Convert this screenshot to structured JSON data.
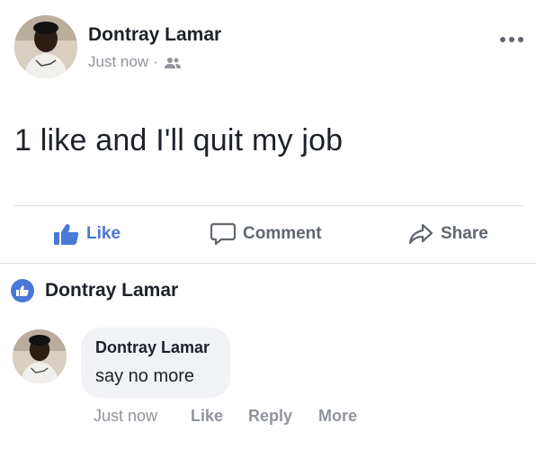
{
  "post": {
    "author": "Dontray Lamar",
    "timestamp": "Just now",
    "separator": "·",
    "audience_icon": "friends-icon",
    "menu_icon": "more-options-icon",
    "text": "1 like and I'll quit my job"
  },
  "actions": {
    "like_label": "Like",
    "comment_label": "Comment",
    "share_label": "Share"
  },
  "reactions": {
    "icon": "like-reaction-icon",
    "names": "Dontray Lamar"
  },
  "comment": {
    "author": "Dontray Lamar",
    "text": "say no more",
    "timestamp": "Just now",
    "like_label": "Like",
    "reply_label": "Reply",
    "more_label": "More"
  },
  "colors": {
    "accent": "#4a78d6",
    "text_primary": "#1d2129",
    "text_secondary": "#90949c",
    "action_gray": "#606770",
    "bubble_bg": "#f0f2f5",
    "divider": "#dadde1"
  }
}
